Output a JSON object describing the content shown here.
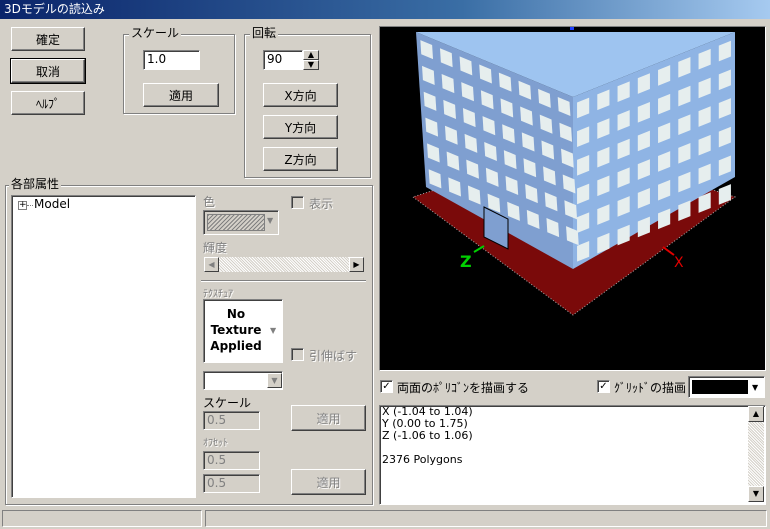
{
  "window": {
    "title": "3Dモデルの読込み"
  },
  "buttons": {
    "ok": "確定",
    "cancel": "取消",
    "help": "ﾍﾙﾌﾟ"
  },
  "scale_group": {
    "label": "スケール",
    "value": "1.0",
    "apply": "適用"
  },
  "rotate_group": {
    "label": "回転",
    "value": "90",
    "x": "X方向",
    "y": "Y方向",
    "z": "Z方向"
  },
  "parts_group": {
    "label": "各部属性",
    "tree": [
      {
        "expander": "+",
        "label": "Model"
      }
    ]
  },
  "attributes": {
    "color_label": "色",
    "show_label": "表示",
    "brightness_label": "輝度",
    "texture_label": "ﾃｸｽﾁｭｱ",
    "texture_preview": [
      "No",
      "Texture",
      "Applied"
    ],
    "stretch_label": "引伸ばす",
    "scale_label": "スケール",
    "scale_value": "0.5",
    "apply_scale": "適用",
    "offset_label": "ｵﾌｾｯﾄ",
    "offset_x": "0.5",
    "offset_y": "0.5",
    "apply_offset": "適用"
  },
  "preview": {
    "axis_x": "X",
    "axis_z": "Z",
    "colors": {
      "background": "#000000",
      "building": "#8fb4e4",
      "base": "#7a0a0a",
      "window": "#e6eeee"
    }
  },
  "options": {
    "double_sided_label": "両面のﾎﾟﾘｺﾞﾝを描画する",
    "double_sided_checked": true,
    "grid_label": "ｸﾞﾘｯﾄﾞの描画",
    "grid_checked": true,
    "grid_color": "#000000"
  },
  "info": {
    "lines": [
      "X (-1.04 to 1.04)",
      "Y (0.00 to 1.75)",
      "Z (-1.06 to 1.06)",
      "",
      "2376 Polygons"
    ]
  }
}
